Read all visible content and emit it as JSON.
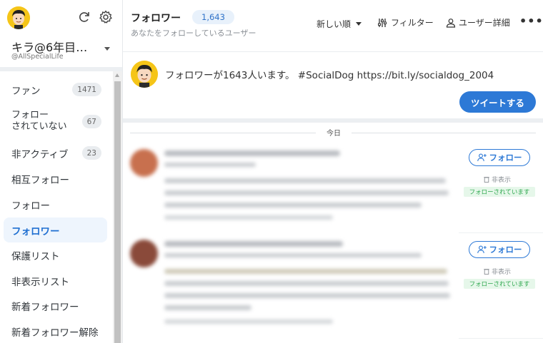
{
  "sidebar": {
    "user_name": "キラ@6年目ブ…",
    "user_handle": "@AllSpecialLife",
    "nav": [
      {
        "label": "ファン",
        "badge": "1471"
      },
      {
        "label": "フォロー\nされていない",
        "badge": "67"
      },
      {
        "label": "非アクティブ",
        "badge": "23"
      },
      {
        "label": "相互フォロー",
        "badge": ""
      },
      {
        "label": "フォロー",
        "badge": ""
      },
      {
        "label": "フォロワー",
        "badge": ""
      },
      {
        "label": "保護リスト",
        "badge": ""
      },
      {
        "label": "非表示リスト",
        "badge": ""
      },
      {
        "label": "新着フォロワー",
        "badge": ""
      },
      {
        "label": "新着フォロワー解除",
        "badge": ""
      }
    ],
    "active_item": "フォロワー"
  },
  "header": {
    "title": "フォロワー",
    "count": "1,643",
    "subtitle": "あなたをフォローしているユーザー",
    "sort_label": "新しい順",
    "filter_label": "フィルター",
    "user_detail_label": "ユーザー詳細",
    "more_label": "•••"
  },
  "compose": {
    "text": "フォロワーが1643人います。 #SocialDog https://bit.ly/socialdog_2004",
    "tweet_button": "ツイートする"
  },
  "feed": {
    "date_label": "今日",
    "cards": [
      {
        "follow_label": "フォロー",
        "hide_label": "非表示",
        "followed_badge": "フォローされています",
        "avatar_color": "#c8704e"
      },
      {
        "follow_label": "フォロー",
        "hide_label": "非表示",
        "followed_badge": "フォローされています",
        "avatar_color": "#8a4a3a"
      }
    ]
  },
  "colors": {
    "accent": "#2d79d6",
    "active_bg": "#eef5fd",
    "followed_green": "#2fa84f",
    "avatar_yellow": "#f5c518"
  },
  "icons": {
    "refresh": "refresh-icon",
    "settings": "gear-icon",
    "filter": "sliders-icon",
    "user": "person-icon",
    "follow": "add-person-icon",
    "hide": "trash-icon"
  }
}
